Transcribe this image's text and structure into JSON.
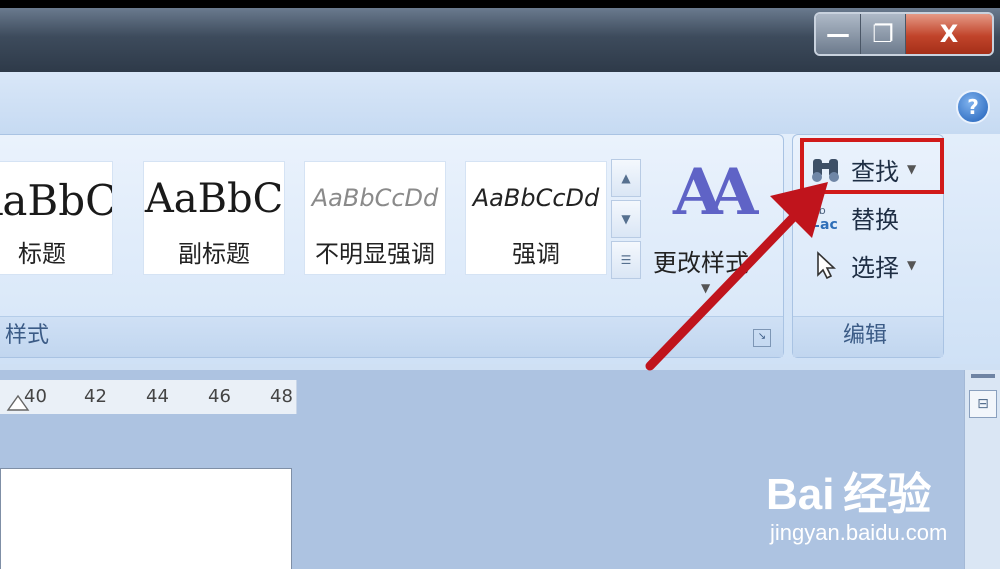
{
  "window": {
    "minimize_glyph": "—",
    "restore_glyph": "❐",
    "close_glyph": "X"
  },
  "help_glyph": "?",
  "styles_group": {
    "label": "样式",
    "items": [
      {
        "sample": "AaBbC",
        "name": "标题"
      },
      {
        "sample": "AaBbC",
        "name": "副标题"
      },
      {
        "sample": "AaBbCcDd",
        "name": "不明显强调"
      },
      {
        "sample": "AaBbCcDd",
        "name": "强调"
      }
    ],
    "change_styles_icon": "AA",
    "change_styles_label": "更改样式"
  },
  "editing_group": {
    "label": "编辑",
    "find": "查找",
    "replace": "替换",
    "select": "选择"
  },
  "ruler": {
    "ticks": [
      "40",
      "42",
      "44",
      "46",
      "48"
    ]
  },
  "watermark": {
    "logo": "Bai 经验",
    "url": "jingyan.baidu.com"
  },
  "colors": {
    "highlight": "#d11a1a",
    "arrow": "#c0141c"
  }
}
